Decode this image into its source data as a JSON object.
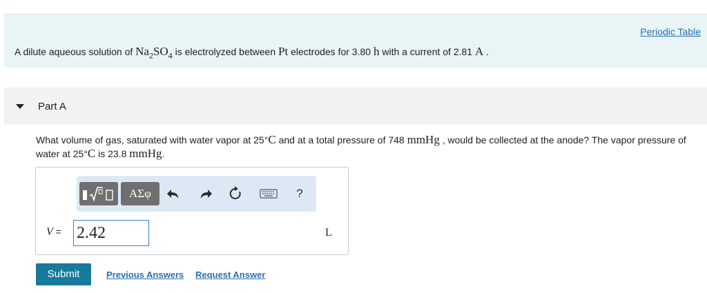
{
  "intro": {
    "periodic_table_link": "Periodic Table",
    "text_1": "A dilute aqueous solution of ",
    "compound_base": "Na",
    "compound_sub1": "2",
    "compound_mid": "SO",
    "compound_sub2": "4",
    "text_2": " is electrolyzed between ",
    "electrode": "Pt",
    "text_3": " electrodes for 3.80 ",
    "time_unit": "h",
    "text_4": " with a current of 2.81 ",
    "current_unit": "A",
    "text_5": " ."
  },
  "part": {
    "title": "Part A"
  },
  "question": {
    "text_1": "What volume of gas, saturated with water vapor at 25",
    "deg_1": "°",
    "unit_c1": "C",
    "text_2": " and at a total pressure of 748 ",
    "unit_p1": "mmHg",
    "text_3": " , would be collected at the anode? The vapor pressure of water at 25",
    "deg_2": "°",
    "unit_c2": "C",
    "text_4": " is 23.8 ",
    "unit_p2": "mmHg",
    "text_5": "."
  },
  "toolbar": {
    "greek_label": "ΑΣφ",
    "undo_icon": "undo-icon",
    "redo_icon": "redo-icon",
    "reset_icon": "reset-icon",
    "keyboard_icon": "keyboard-icon",
    "help_label": "?"
  },
  "answer": {
    "variable": "V",
    "equals": " =",
    "value": "2.42",
    "unit": "L"
  },
  "actions": {
    "submit": "Submit",
    "previous_answers": "Previous Answers",
    "request_answer": "Request Answer"
  },
  "colors": {
    "accent": "#177a9c",
    "link": "#2a6fae",
    "intro_bg": "#e8f4f6",
    "toolbar_bg": "#dce9f5"
  }
}
